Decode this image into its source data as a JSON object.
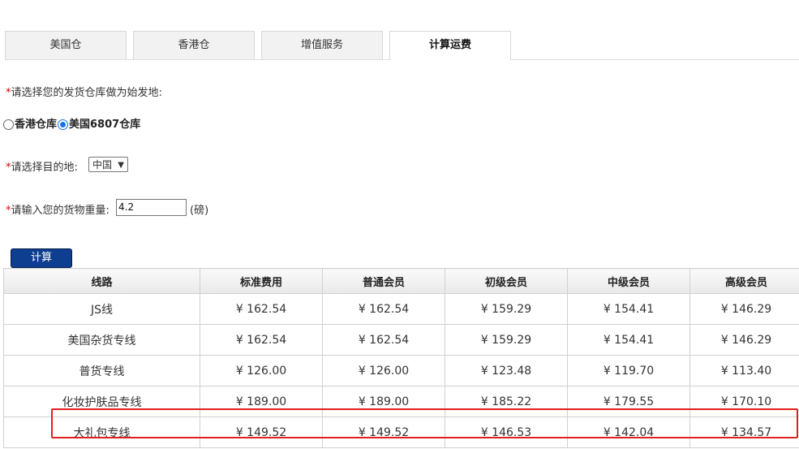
{
  "tabs": [
    {
      "label": "美国仓",
      "active": false
    },
    {
      "label": "香港仓",
      "active": false
    },
    {
      "label": "增值服务",
      "active": false
    },
    {
      "label": "计算运费",
      "active": true
    }
  ],
  "form": {
    "required_mark": "*",
    "origin_label": "请选择您的发货仓库做为始发地:",
    "origin_options": [
      {
        "label": "香港仓库",
        "checked": false
      },
      {
        "label": "美国6807仓库",
        "checked": true
      }
    ],
    "destination_label": "请选择目的地:",
    "destination_value": "中国",
    "weight_label": "请输入您的货物重量:",
    "weight_value": "4.2",
    "weight_unit": "(磅)",
    "calc_button": "计算"
  },
  "table": {
    "headers": [
      "线路",
      "标准费用",
      "普通会员",
      "初级会员",
      "中级会员",
      "高级会员"
    ],
    "rows": [
      [
        "JS线",
        "¥ 162.54",
        "¥ 162.54",
        "¥ 159.29",
        "¥ 154.41",
        "¥ 146.29"
      ],
      [
        "美国杂货专线",
        "¥ 162.54",
        "¥ 162.54",
        "¥ 159.29",
        "¥ 154.41",
        "¥ 146.29"
      ],
      [
        "普货专线",
        "¥ 126.00",
        "¥ 126.00",
        "¥ 123.48",
        "¥ 119.70",
        "¥ 113.40"
      ],
      [
        "化妆护肤品专线",
        "¥ 189.00",
        "¥ 189.00",
        "¥ 185.22",
        "¥ 179.55",
        "¥ 170.10"
      ],
      [
        "大礼包专线",
        "¥ 149.52",
        "¥ 149.52",
        "¥ 146.53",
        "¥ 142.04",
        "¥ 134.57"
      ]
    ],
    "highlighted_row": 4
  },
  "colors": {
    "accent_button": "#0d3e8f",
    "required": "#d20000",
    "highlight": "#e02020"
  }
}
